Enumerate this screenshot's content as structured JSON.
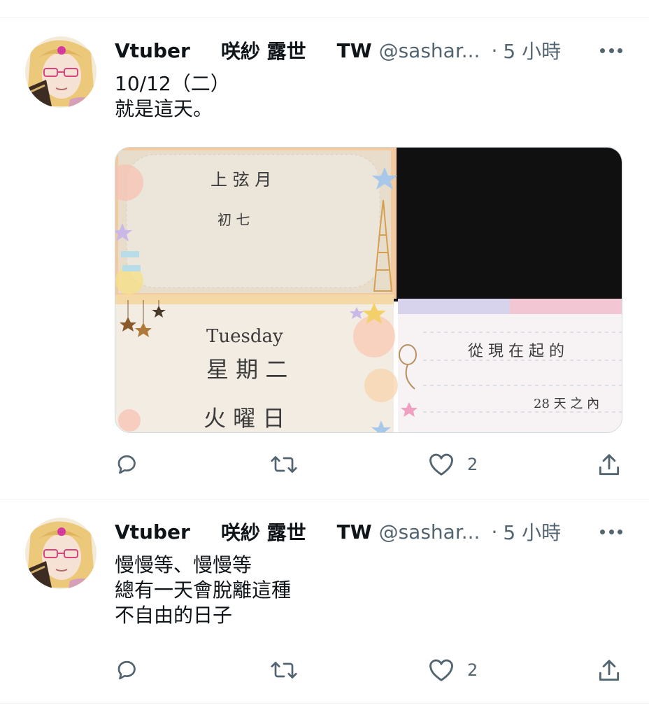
{
  "tweets": [
    {
      "author": {
        "label_1": "Vtuber",
        "label_2": "咲紗 露世",
        "label_3": "TW",
        "handle": "@sashar..."
      },
      "dot": "·",
      "time": "5 小時",
      "text": "10/12（二）\n就是這天。",
      "media": {
        "card1": {
          "line1": "上 弦 月",
          "line2": "初 七"
        },
        "card2": {
          "line1": "Tuesday",
          "line2": "星 期 二",
          "line3": "火 曜 日"
        },
        "card3": {
          "line1": "從 現 在 起 的",
          "line2": "28 天 之 內"
        }
      },
      "actions": {
        "reply_count": "",
        "retweet_count": "",
        "like_count": "2"
      }
    },
    {
      "author": {
        "label_1": "Vtuber",
        "label_2": "咲紗 露世",
        "label_3": "TW",
        "handle": "@sashar..."
      },
      "dot": "·",
      "time": "5 小時",
      "text": "慢慢等、慢慢等\n總有一天會脫離這種\n不自由的日子",
      "actions": {
        "reply_count": "",
        "retweet_count": "",
        "like_count": "2"
      }
    }
  ],
  "icons": {
    "reply": "reply-icon",
    "retweet": "retweet-icon",
    "like": "heart-icon",
    "share": "share-icon",
    "more": "more-icon"
  },
  "colors": {
    "text": "#0f1419",
    "secondary": "#536471",
    "divider": "#eff3f4"
  }
}
